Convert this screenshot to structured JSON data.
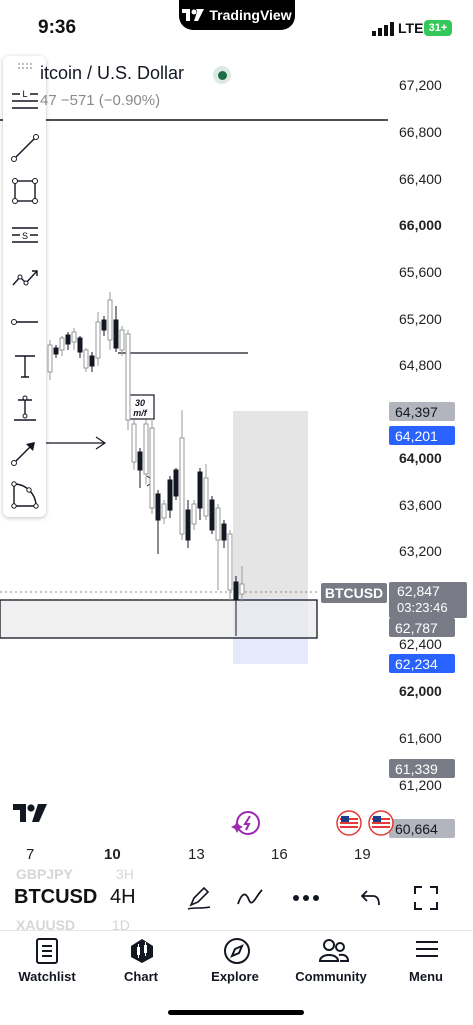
{
  "status": {
    "time": "9:36",
    "network": "LTE",
    "battery": "31+"
  },
  "island": {
    "brand": "TradingView"
  },
  "header": {
    "title": "itcoin / U.S. Dollar",
    "change": "47 −571 (−0.90%)"
  },
  "price_axis": {
    "labels": [
      {
        "text": "67,200",
        "bold": false
      },
      {
        "text": "66,800",
        "bold": false
      },
      {
        "text": "66,400",
        "bold": false
      },
      {
        "text": "66,000",
        "bold": true
      },
      {
        "text": "65,600",
        "bold": false
      },
      {
        "text": "65,200",
        "bold": false
      },
      {
        "text": "64,800",
        "bold": false
      },
      {
        "text": "64,000",
        "bold": true
      },
      {
        "text": "63,600",
        "bold": false
      },
      {
        "text": "63,200",
        "bold": false
      },
      {
        "text": "62,400",
        "bold": false
      },
      {
        "text": "62,000",
        "bold": true
      },
      {
        "text": "61,600",
        "bold": false
      },
      {
        "text": "61,200",
        "bold": false
      }
    ],
    "tags": {
      "gray1": "64,397",
      "blue1": "64,201",
      "current_symbol": "BTCUSD",
      "current_price": "62,847",
      "countdown": "03:23:46",
      "gray2": "62,787",
      "blue2": "62,234",
      "gray3": "61,339",
      "gray4": "60,664"
    }
  },
  "annotation": {
    "label_line1": "30",
    "label_line2": "m/f"
  },
  "time_axis": [
    {
      "text": "7",
      "bold": false
    },
    {
      "text": "10",
      "bold": true
    },
    {
      "text": "13",
      "bold": false
    },
    {
      "text": "16",
      "bold": false
    },
    {
      "text": "19",
      "bold": false
    }
  ],
  "symbol_bar": {
    "prev_symbol": "GBPJPY",
    "prev_tf": "3H",
    "symbol": "BTCUSD",
    "timeframe": "4H",
    "next_symbol": "XAUUSD",
    "next_tf": "1D"
  },
  "nav": [
    {
      "label": "Watchlist",
      "icon": "watchlist-icon"
    },
    {
      "label": "Chart",
      "icon": "chart-icon"
    },
    {
      "label": "Explore",
      "icon": "compass-icon"
    },
    {
      "label": "Community",
      "icon": "community-icon"
    },
    {
      "label": "Menu",
      "icon": "menu-icon"
    }
  ],
  "colors": {
    "blue_tag": "#2962ff",
    "gray_tag": "#787b86",
    "live_dot": "#1e6b4a"
  }
}
